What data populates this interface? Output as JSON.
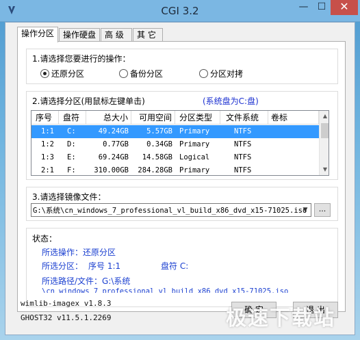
{
  "window": {
    "title": "CGI 3.2",
    "min": "—",
    "max": "☐",
    "close": "✕"
  },
  "tabs": [
    "操作分区",
    "操作硬盘",
    "高 级",
    "其 它"
  ],
  "operation": {
    "label": "1.请选择您要进行的操作：",
    "options": [
      "还原分区",
      "备份分区",
      "分区对拷"
    ],
    "selected": "还原分区"
  },
  "partition": {
    "label": "2.请选择分区(用鼠标左键单击)",
    "sys_note": "(系统盘为C:盘)",
    "columns": [
      "序号",
      "盘符",
      "总大小",
      "可用空间",
      "分区类型",
      "文件系统",
      "卷标"
    ],
    "rows": [
      {
        "no": "1:1",
        "drive": "C:",
        "total": "49.24GB",
        "free": "5.57GB",
        "type": "Primary",
        "fs": "NTFS",
        "label": "",
        "selected": true
      },
      {
        "no": "1:2",
        "drive": "D:",
        "total": "0.77GB",
        "free": "0.34GB",
        "type": "Primary",
        "fs": "NTFS",
        "label": ""
      },
      {
        "no": "1:3",
        "drive": "E:",
        "total": "69.24GB",
        "free": "14.58GB",
        "type": "Logical",
        "fs": "NTFS",
        "label": ""
      },
      {
        "no": "2:1",
        "drive": "F:",
        "total": "310.00GB",
        "free": "284.28GB",
        "type": "Primary",
        "fs": "NTFS",
        "label": ""
      }
    ]
  },
  "image": {
    "label": "3.请选择镜像文件：",
    "path": "G:\\系统\\cn_windows_7_professional_vl_build_x86_dvd_x15-71025.iso",
    "browse": "..."
  },
  "status": {
    "label": "状态：",
    "op": "所选操作：还原分区",
    "part_label": "所选分区：",
    "part_value": "序号 1:1",
    "drive_label": "盘符 C:",
    "path_line": "所选路径/文件：G:\\系统",
    "path_line2": "\\cn_windows_7_professional_vl_build_x86_dvd_x15-71025.iso"
  },
  "versions": [
    "wimlib-imagex v1.8.3",
    "GHOST32 v11.5.1.2269"
  ],
  "buttons": {
    "ok": "确 定",
    "cancel": "退 出"
  },
  "watermark": "极速下载站"
}
